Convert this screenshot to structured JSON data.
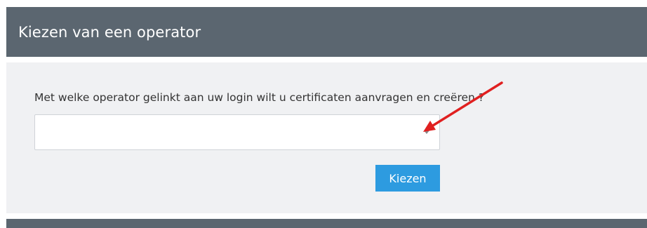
{
  "header": {
    "title": "Kiezen van een operator"
  },
  "form": {
    "question": "Met welke operator gelinkt aan uw login wilt u certificaten aanvragen en creëren ?",
    "operator_select_value": "",
    "submit_label": "Kiezen"
  },
  "colors": {
    "header_bg": "#5b6670",
    "panel_bg": "#f0f1f3",
    "button_bg": "#2d9be0",
    "annotation_arrow": "#e02020"
  },
  "icons": {
    "select_arrow": "chevron-down-icon",
    "annotation": "annotation-arrow-icon"
  }
}
